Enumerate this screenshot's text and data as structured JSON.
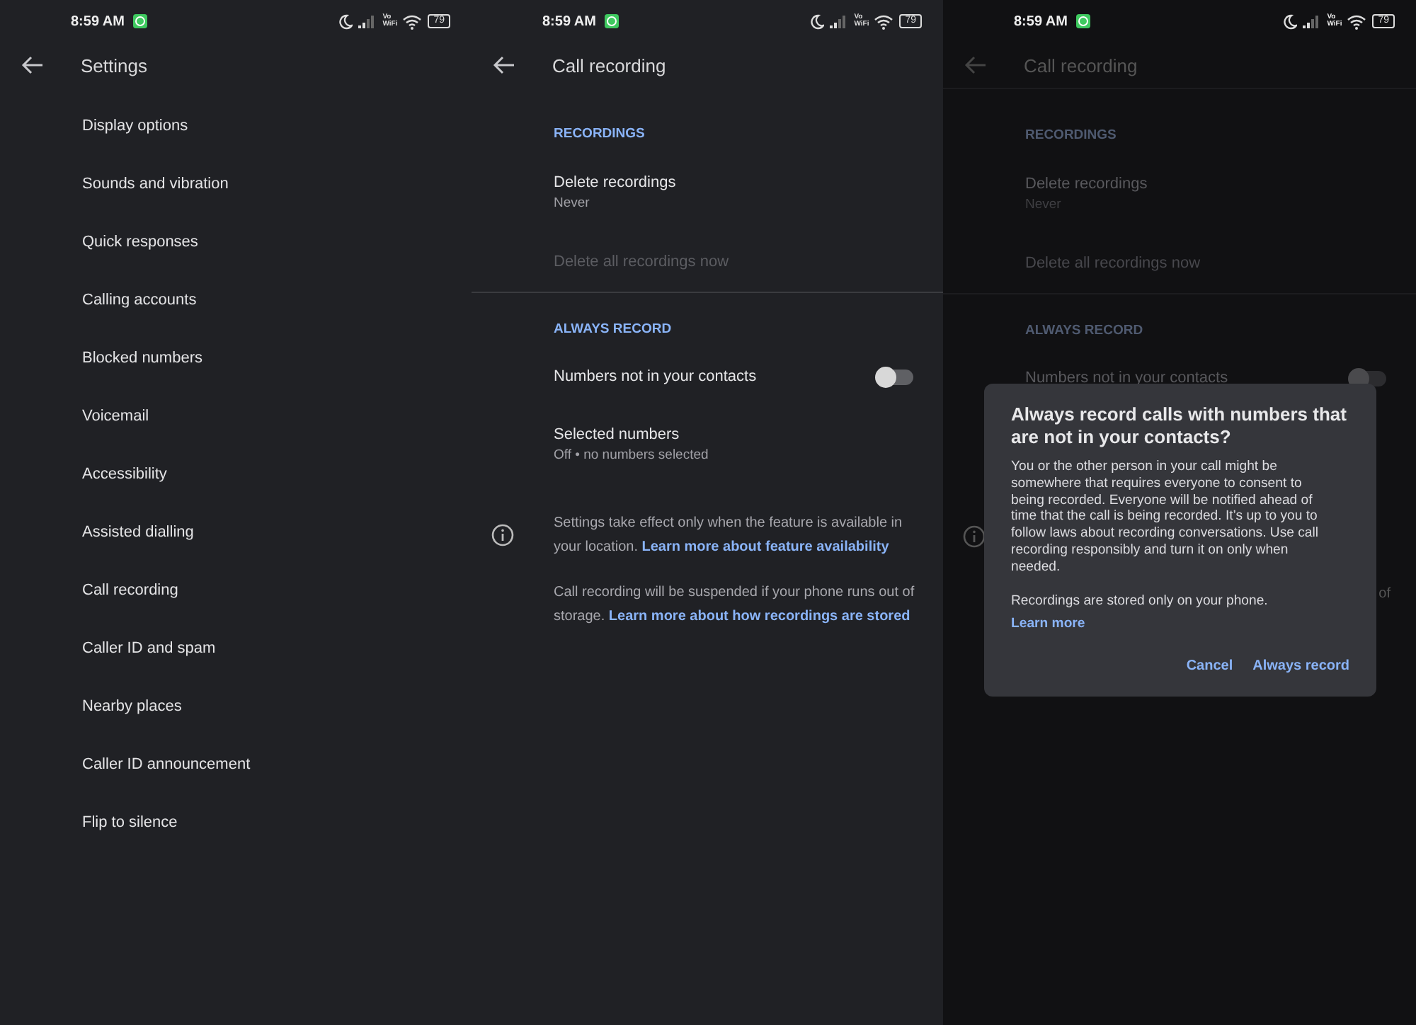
{
  "screens": [
    {
      "kind": "settings",
      "dimmed": false,
      "status": {
        "time": "8:59 AM",
        "network": "Vo WiFi",
        "battery": "79"
      },
      "title": "Settings",
      "items": [
        "Display options",
        "Sounds and vibration",
        "Quick responses",
        "Calling accounts",
        "Blocked numbers",
        "Voicemail",
        "Accessibility",
        "Assisted dialling",
        "Call recording",
        "Caller ID and spam",
        "Nearby places",
        "Caller ID announcement",
        "Flip to silence"
      ]
    },
    {
      "kind": "call_recording",
      "dimmed": false,
      "status": {
        "time": "8:59 AM",
        "network": "Vo WiFi",
        "battery": "79"
      },
      "title": "Call recording",
      "sections": [
        {
          "header": "RECORDINGS",
          "rows": [
            {
              "kind": "two_line",
              "title": "Delete recordings",
              "subtitle": "Never"
            },
            {
              "kind": "disabled",
              "title": "Delete all recordings now"
            }
          ]
        },
        {
          "header": "ALWAYS RECORD",
          "rows": [
            {
              "kind": "toggle",
              "title": "Numbers not in your contacts",
              "on": false
            },
            {
              "kind": "two_line",
              "title": "Selected numbers",
              "subtitle": "Off • no numbers selected"
            }
          ]
        }
      ],
      "notes": [
        {
          "kind": "info",
          "text": "Settings take effect only when the feature is available in your location.",
          "link": "Learn more about feature availability"
        },
        {
          "kind": "plain",
          "text": "Call recording will be suspended if your phone runs out of storage.",
          "link": "Learn more about how recordings are stored"
        }
      ]
    },
    {
      "kind": "call_recording",
      "dimmed": true,
      "status": {
        "time": "8:59 AM",
        "network": "Vo WiFi",
        "battery": "79"
      },
      "title": "Call recording",
      "sections": [
        {
          "header": "RECORDINGS",
          "rows": [
            {
              "kind": "two_line",
              "title": "Delete recordings",
              "subtitle": "Never"
            },
            {
              "kind": "disabled",
              "title": "Delete all recordings now"
            }
          ]
        },
        {
          "header": "ALWAYS RECORD",
          "rows": [
            {
              "kind": "toggle",
              "title": "Numbers not in your contacts",
              "on": false
            },
            {
              "kind": "covered"
            }
          ]
        }
      ],
      "notes": [
        {
          "kind": "info_covered"
        },
        {
          "kind": "tail",
          "text": "of"
        }
      ],
      "dialog": {
        "title": "Always record calls with numbers that are not in your contacts?",
        "body": "You or the other person in your call might be somewhere that requires everyone to consent to being recorded. Everyone will be notified ahead of time that the call is being recorded. It’s up to you to follow laws about recording conversations. Use call recording responsibly and turn it on only when needed.",
        "note": "Recordings are stored only on your phone.",
        "link": "Learn more",
        "buttons": [
          "Cancel",
          "Always record"
        ]
      }
    }
  ]
}
